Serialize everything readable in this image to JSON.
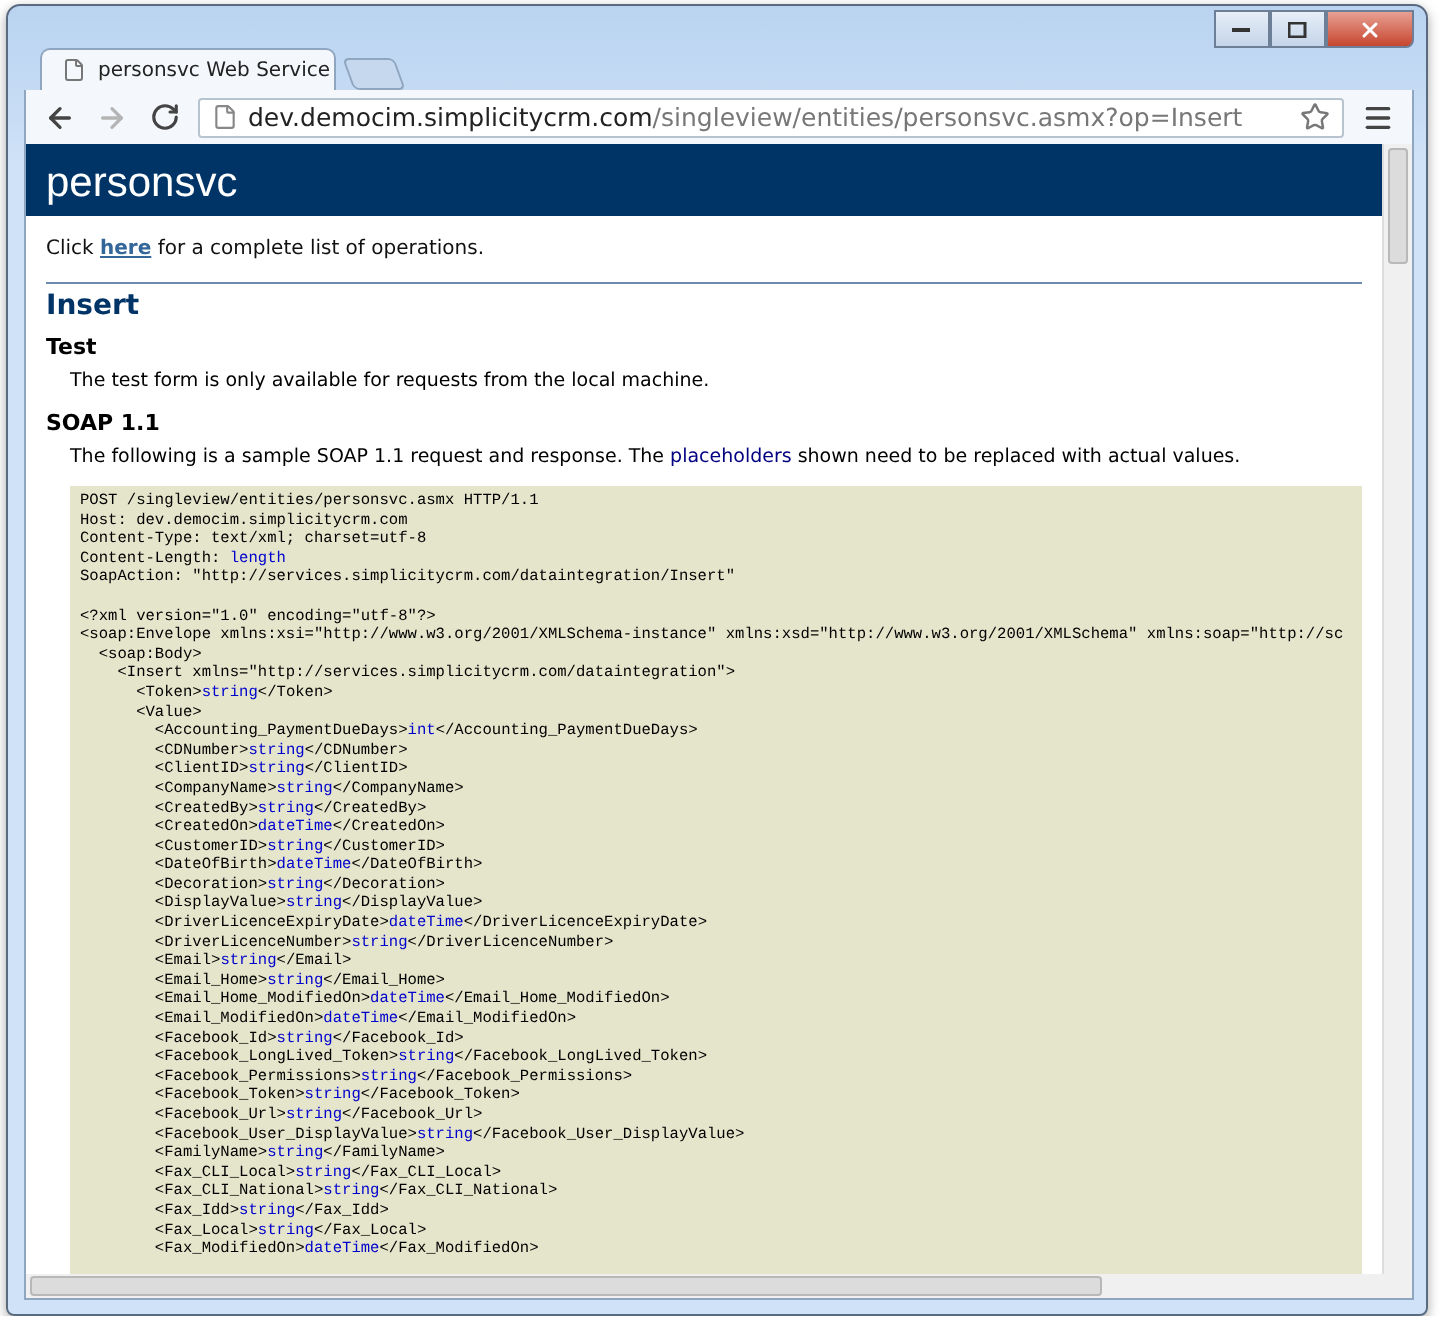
{
  "tab": {
    "title": "personsvc Web Service"
  },
  "address": {
    "host": "dev.democim.simplicitycrm.com",
    "path": "/singleview/entities/personsvc.asmx?op=Insert"
  },
  "page": {
    "title": "personsvc",
    "intro_before": "Click ",
    "intro_link": "here",
    "intro_after": " for a complete list of operations.",
    "operation": "Insert",
    "sections": [
      {
        "heading": "Test",
        "before": "The test form is only available for requests from the local machine."
      },
      {
        "heading": "SOAP 1.1",
        "before": "The following is a sample SOAP 1.1 request and response. The ",
        "highlight": "placeholders",
        "after": " shown need to be replaced with actual values."
      }
    ]
  },
  "code_lines": [
    {
      "code": "POST /singleview/entities/personsvc.asmx HTTP/1.1"
    },
    {
      "code": "Host: dev.democim.simplicitycrm.com"
    },
    {
      "code": "Content-Type: text/xml; charset=utf-8"
    },
    {
      "code": "Content-Length: ",
      "placeholder": "length"
    },
    {
      "code": "SoapAction: \"http://services.simplicitycrm.com/dataintegration/Insert\""
    },
    {
      "code": "<?xml version=\"1.0\" encoding=\"utf-8\"?>",
      "gap_before": true
    },
    {
      "code": "<soap:Envelope xmlns:xsi=\"http://www.w3.org/2001/XMLSchema-instance\" xmlns:xsd=\"http://www.w3.org/2001/XMLSchema\" xmlns:soap=\"http://sc"
    },
    {
      "code": "  <soap:Body>"
    },
    {
      "code": "    <Insert xmlns=\"http://services.simplicitycrm.com/dataintegration\">"
    },
    {
      "code": "      <Token>",
      "placeholder": "string",
      "tail": "</Token>"
    },
    {
      "code": "      <Value>"
    },
    {
      "code": "        <Accounting_PaymentDueDays>",
      "placeholder": "int",
      "tail": "</Accounting_PaymentDueDays>"
    },
    {
      "code": "        <CDNumber>",
      "placeholder": "string",
      "tail": "</CDNumber>"
    },
    {
      "code": "        <ClientID>",
      "placeholder": "string",
      "tail": "</ClientID>"
    },
    {
      "code": "        <CompanyName>",
      "placeholder": "string",
      "tail": "</CompanyName>"
    },
    {
      "code": "        <CreatedBy>",
      "placeholder": "string",
      "tail": "</CreatedBy>"
    },
    {
      "code": "        <CreatedOn>",
      "placeholder": "dateTime",
      "tail": "</CreatedOn>"
    },
    {
      "code": "        <CustomerID>",
      "placeholder": "string",
      "tail": "</CustomerID>"
    },
    {
      "code": "        <DateOfBirth>",
      "placeholder": "dateTime",
      "tail": "</DateOfBirth>"
    },
    {
      "code": "        <Decoration>",
      "placeholder": "string",
      "tail": "</Decoration>"
    },
    {
      "code": "        <DisplayValue>",
      "placeholder": "string",
      "tail": "</DisplayValue>"
    },
    {
      "code": "        <DriverLicenceExpiryDate>",
      "placeholder": "dateTime",
      "tail": "</DriverLicenceExpiryDate>"
    },
    {
      "code": "        <DriverLicenceNumber>",
      "placeholder": "string",
      "tail": "</DriverLicenceNumber>"
    },
    {
      "code": "        <Email>",
      "placeholder": "string",
      "tail": "</Email>"
    },
    {
      "code": "        <Email_Home>",
      "placeholder": "string",
      "tail": "</Email_Home>"
    },
    {
      "code": "        <Email_Home_ModifiedOn>",
      "placeholder": "dateTime",
      "tail": "</Email_Home_ModifiedOn>"
    },
    {
      "code": "        <Email_ModifiedOn>",
      "placeholder": "dateTime",
      "tail": "</Email_ModifiedOn>"
    },
    {
      "code": "        <Facebook_Id>",
      "placeholder": "string",
      "tail": "</Facebook_Id>"
    },
    {
      "code": "        <Facebook_LongLived_Token>",
      "placeholder": "string",
      "tail": "</Facebook_LongLived_Token>"
    },
    {
      "code": "        <Facebook_Permissions>",
      "placeholder": "string",
      "tail": "</Facebook_Permissions>"
    },
    {
      "code": "        <Facebook_Token>",
      "placeholder": "string",
      "tail": "</Facebook_Token>"
    },
    {
      "code": "        <Facebook_Url>",
      "placeholder": "string",
      "tail": "</Facebook_Url>"
    },
    {
      "code": "        <Facebook_User_DisplayValue>",
      "placeholder": "string",
      "tail": "</Facebook_User_DisplayValue>"
    },
    {
      "code": "        <FamilyName>",
      "placeholder": "string",
      "tail": "</FamilyName>"
    },
    {
      "code": "        <Fax_CLI_Local>",
      "placeholder": "string",
      "tail": "</Fax_CLI_Local>"
    },
    {
      "code": "        <Fax_CLI_National>",
      "placeholder": "string",
      "tail": "</Fax_CLI_National>"
    },
    {
      "code": "        <Fax_Idd>",
      "placeholder": "string",
      "tail": "</Fax_Idd>"
    },
    {
      "code": "        <Fax_Local>",
      "placeholder": "string",
      "tail": "</Fax_Local>"
    },
    {
      "code": "        <Fax_ModifiedOn>",
      "placeholder": "dateTime",
      "tail": "</Fax_ModifiedOn>"
    }
  ]
}
